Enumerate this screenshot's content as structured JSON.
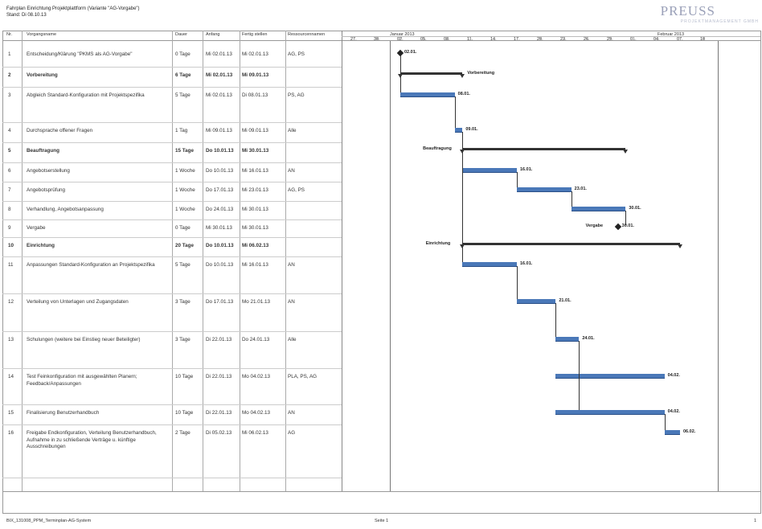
{
  "header": {
    "title_line1": "Fahrplan Einrichtung Projektplattform (Variante \"AG-Vorgabe\")",
    "title_line2": "Stand: Di 08.10.13",
    "logo": "PREUSS",
    "logo_sub": "PROJEKTMANAGEMENT GMBH"
  },
  "columns": {
    "nr": "Nr.",
    "name": "Vorgangsname",
    "dauer": "Dauer",
    "anfang": "Anfang",
    "fertig": "Fertig stellen",
    "ressourcen": "Ressourcennamen"
  },
  "timeline": {
    "months": [
      "Januar 2013",
      "Februar 2013"
    ],
    "days": [
      "27.",
      "30.",
      "02.",
      "05.",
      "08.",
      "11.",
      "14.",
      "17.",
      "20.",
      "23.",
      "26.",
      "29.",
      "01.",
      "04.",
      "07.",
      "10"
    ]
  },
  "rows": [
    {
      "nr": "1",
      "name": "Entscheidung/Klärung \"PKMS als AG-Vorgabe\"",
      "dauer": "0 Tage",
      "anfang": "Mi 02.01.13",
      "fertig": "Mi 02.01.13",
      "res": "AG, PS",
      "bold": false,
      "kind": "milestone",
      "label": "02.01."
    },
    {
      "nr": "2",
      "name": "Vorbereitung",
      "dauer": "6 Tage",
      "anfang": "Mi 02.01.13",
      "fertig": "Mi 09.01.13",
      "res": "",
      "bold": true,
      "kind": "summary",
      "label": "Vorbereitung"
    },
    {
      "nr": "3",
      "name": "Abgleich Standard-Konfiguration mit Projektspezifika",
      "dauer": "5 Tage",
      "anfang": "Mi 02.01.13",
      "fertig": "Di 08.01.13",
      "res": "PS, AG",
      "bold": false,
      "kind": "task",
      "label": "08.01."
    },
    {
      "nr": "4",
      "name": "Durchsprache offener Fragen",
      "dauer": "1 Tag",
      "anfang": "Mi 09.01.13",
      "fertig": "Mi 09.01.13",
      "res": "Alle",
      "bold": false,
      "kind": "task",
      "label": "09.01."
    },
    {
      "nr": "5",
      "name": "Beauftragung",
      "dauer": "15 Tage",
      "anfang": "Do 10.01.13",
      "fertig": "Mi 30.01.13",
      "res": "",
      "bold": true,
      "kind": "summary",
      "label": "Beauftragung"
    },
    {
      "nr": "6",
      "name": "Angebotserstellung",
      "dauer": "1 Woche",
      "anfang": "Do 10.01.13",
      "fertig": "Mi 16.01.13",
      "res": "AN",
      "bold": false,
      "kind": "task",
      "label": "16.01."
    },
    {
      "nr": "7",
      "name": "Angebotsprüfung",
      "dauer": "1 Woche",
      "anfang": "Do 17.01.13",
      "fertig": "Mi 23.01.13",
      "res": "AG, PS",
      "bold": false,
      "kind": "task",
      "label": "23.01."
    },
    {
      "nr": "8",
      "name": "Verhandlung, Angebotsanpassung",
      "dauer": "1 Woche",
      "anfang": "Do 24.01.13",
      "fertig": "Mi 30.01.13",
      "res": "",
      "bold": false,
      "kind": "task",
      "label": "30.01."
    },
    {
      "nr": "9",
      "name": "Vergabe",
      "dauer": "0 Tage",
      "anfang": "Mi 30.01.13",
      "fertig": "Mi 30.01.13",
      "res": "",
      "bold": false,
      "kind": "milestone",
      "label": "30.01.",
      "prelabel": "Vergabe"
    },
    {
      "nr": "10",
      "name": "Einrichtung",
      "dauer": "20 Tage",
      "anfang": "Do 10.01.13",
      "fertig": "Mi 06.02.13",
      "res": "",
      "bold": true,
      "kind": "summary",
      "label": "Einrichtung"
    },
    {
      "nr": "11",
      "name": "Anpassungen Standard-Konfiguration an Projektspezifika",
      "dauer": "5 Tage",
      "anfang": "Do 10.01.13",
      "fertig": "Mi 16.01.13",
      "res": "AN",
      "bold": false,
      "kind": "task",
      "label": "16.01."
    },
    {
      "nr": "12",
      "name": "Verteilung von Unterlagen und Zugangsdaten",
      "dauer": "3 Tage",
      "anfang": "Do 17.01.13",
      "fertig": "Mo 21.01.13",
      "res": "AN",
      "bold": false,
      "kind": "task",
      "label": "21.01."
    },
    {
      "nr": "13",
      "name": "Schulungen (weitere bei Einstieg neuer Beteiligter)",
      "dauer": "3 Tage",
      "anfang": "Di 22.01.13",
      "fertig": "Do 24.01.13",
      "res": "Alle",
      "bold": false,
      "kind": "task",
      "label": "24.01."
    },
    {
      "nr": "14",
      "name": "Test Feinkonfiguration mit ausgewählten Planern; Feedback/Anpassungen",
      "dauer": "10 Tage",
      "anfang": "Di 22.01.13",
      "fertig": "Mo 04.02.13",
      "res": "PLA, PS, AG",
      "bold": false,
      "kind": "task",
      "label": "04.02."
    },
    {
      "nr": "15",
      "name": "Finalisierung Benutzerhandbuch",
      "dauer": "10 Tage",
      "anfang": "Di 22.01.13",
      "fertig": "Mo 04.02.13",
      "res": "AN",
      "bold": false,
      "kind": "task",
      "label": "04.02."
    },
    {
      "nr": "16",
      "name": "Freigabe Endkonfiguration, Verteilung Benutzerhandbuch, Aufnahme in zu schließende Verträge u. künftige Ausschreibungen",
      "dauer": "2 Tage",
      "anfang": "Di 05.02.13",
      "fertig": "Mi 06.02.13",
      "res": "AG",
      "bold": false,
      "kind": "task",
      "label": "06.02."
    }
  ],
  "footer": {
    "file": "BIX_131008_PPM_Terminplan-AG-System",
    "page": "Seite 1",
    "page_num": "1"
  }
}
